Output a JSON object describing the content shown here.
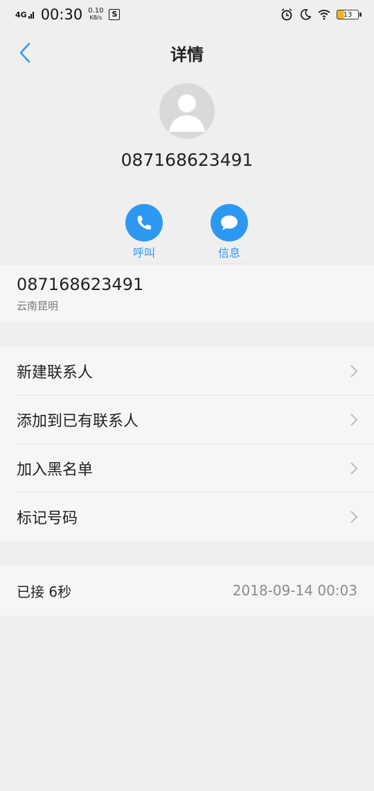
{
  "status_bar": {
    "network": "4G",
    "time": "00:30",
    "speed": "0.10",
    "speed_unit": "KB/s",
    "battery": "13"
  },
  "header": {
    "title": "详情"
  },
  "caller": {
    "number": "087168623491"
  },
  "actions": {
    "call_label": "呼叫",
    "message_label": "信息"
  },
  "info": {
    "number": "087168623491",
    "location": "云南昆明"
  },
  "menu": {
    "items": [
      {
        "label": "新建联系人"
      },
      {
        "label": "添加到已有联系人"
      },
      {
        "label": "加入黑名单"
      },
      {
        "label": "标记号码"
      }
    ]
  },
  "call_log": {
    "status": "已接 6秒",
    "time": "2018-09-14 00:03"
  },
  "colors": {
    "accent": "#2d98f2",
    "background": "#efefef",
    "card": "#f6f6f6"
  }
}
